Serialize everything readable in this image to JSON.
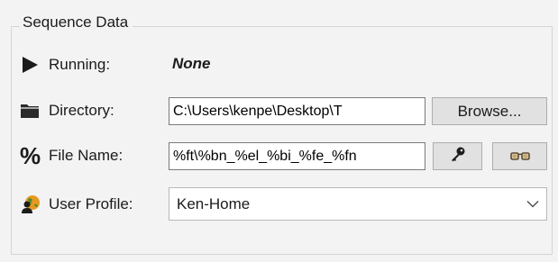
{
  "group": {
    "title": "Sequence Data"
  },
  "running": {
    "icon": "play-icon",
    "label": "Running:",
    "value": "None"
  },
  "directory": {
    "icon": "folder-icon",
    "label": "Directory:",
    "value": "C:\\Users\\kenpe\\Desktop\\T",
    "browse_label": "Browse..."
  },
  "file_name": {
    "icon": "percent-icon",
    "label": "File Name:",
    "value": "%ft\\%bn_%el_%bi_%fe_%fn",
    "key_button_icon": "key-icon",
    "glasses_button_icon": "glasses-icon"
  },
  "user_profile": {
    "icon": "user-profile-icon",
    "label": "User Profile:",
    "selected": "Ken-Home"
  }
}
